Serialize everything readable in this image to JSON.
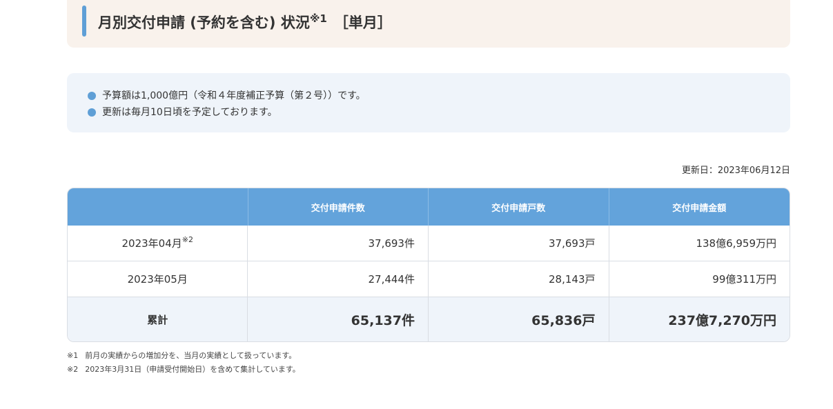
{
  "heading": {
    "title": "月別交付申請 (予約を含む) 状況",
    "title_note": "※1",
    "suffix": "［単月］"
  },
  "notes": [
    "予算額は1,000億円（令和４年度補正予算（第２号））です。",
    "更新は毎月10日頃を予定しております。"
  ],
  "update_date": "更新日：2023年06月12日",
  "table": {
    "headers": [
      "",
      "交付申請件数",
      "交付申請戸数",
      "交付申請金額"
    ],
    "rows": [
      {
        "label": "2023年04月",
        "note": "※2",
        "count": "37,693件",
        "units": "37,693戸",
        "amount": "138億6,959万円"
      },
      {
        "label": "2023年05月",
        "note": "",
        "count": "27,444件",
        "units": "28,143戸",
        "amount": "99億311万円"
      }
    ],
    "total": {
      "label": "累計",
      "count": "65,137件",
      "units": "65,836戸",
      "amount": "237億7,270万円"
    }
  },
  "footnotes": [
    {
      "mark": "※1",
      "text": "前月の実績からの増加分を、当月の実績として扱っています。"
    },
    {
      "mark": "※2",
      "text": "2023年3月31日（申請受付開始日）を含めて集計しています。"
    }
  ],
  "colors": {
    "accent": "#5f9fd6",
    "header_bg": "#63a3db",
    "heading_bg": "#f9f2ec",
    "notes_bg": "#eff4fa"
  }
}
